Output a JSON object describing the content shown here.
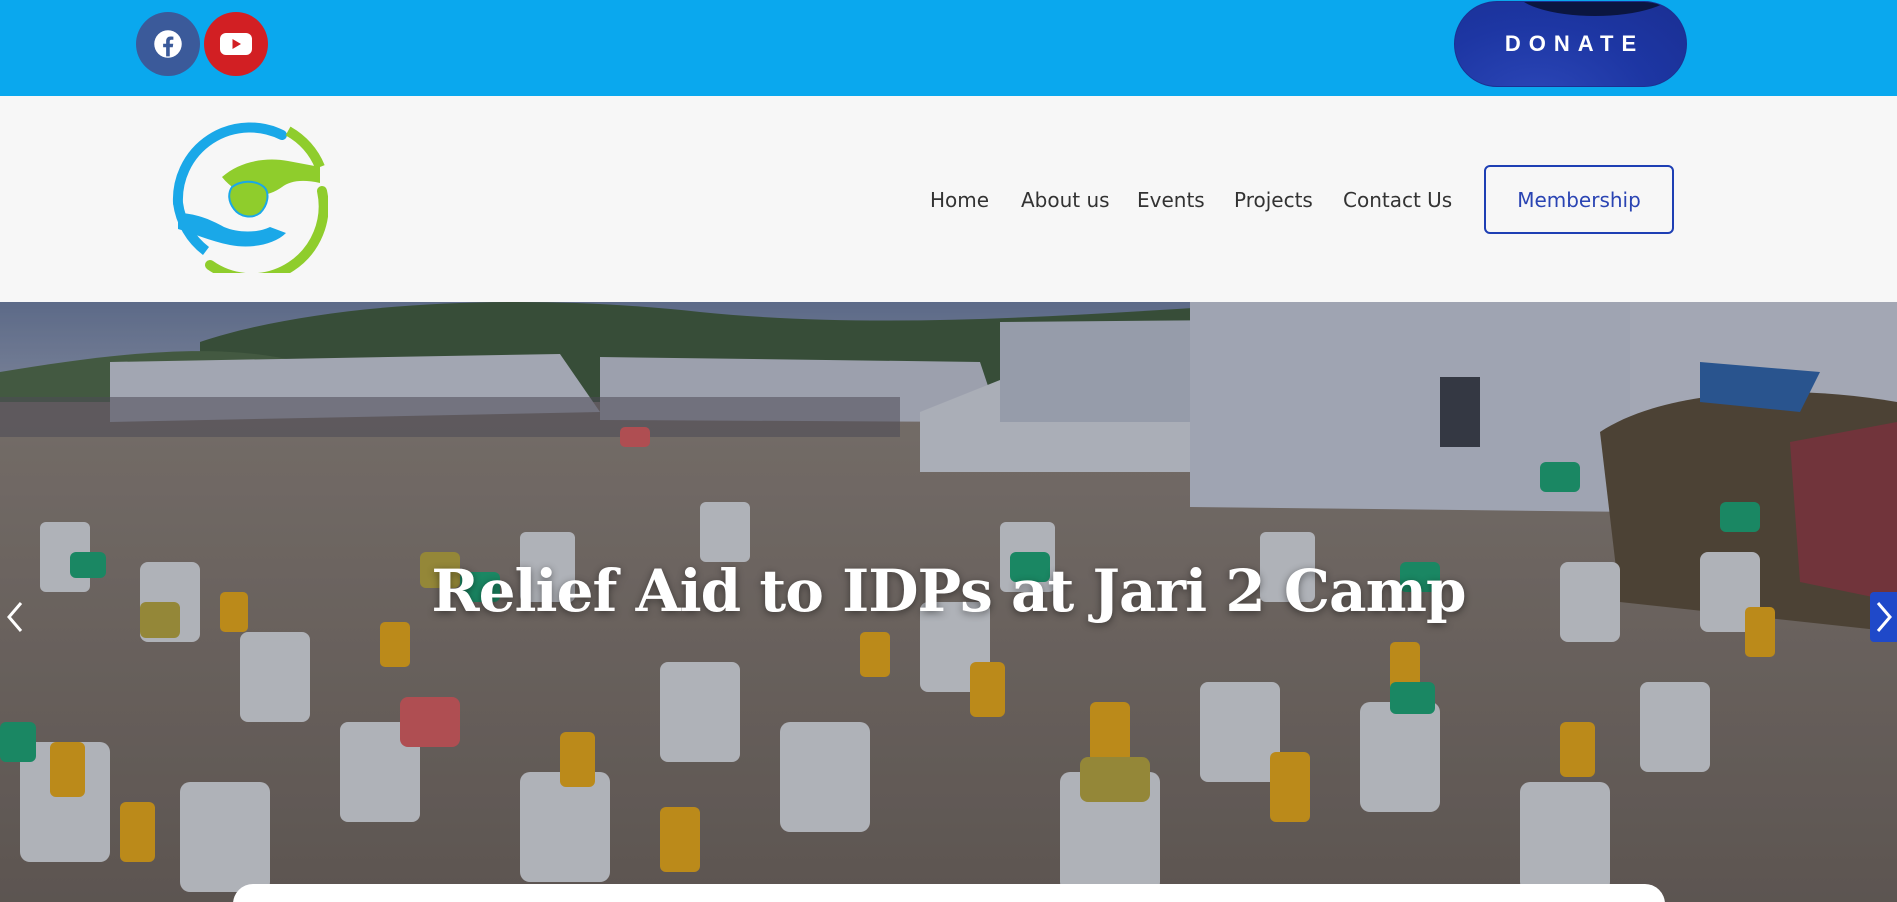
{
  "topbar": {
    "social": [
      {
        "name": "facebook-icon",
        "color": "#3b5a9a"
      },
      {
        "name": "youtube-icon",
        "color": "#d21f23"
      }
    ],
    "donate_label": "DONATE",
    "background": "#0aa8ee"
  },
  "header": {
    "logo_icon": "hands-holding-ethiopia-map-logo",
    "nav": {
      "home": "Home",
      "about": "About us",
      "events": "Events",
      "projects": "Projects",
      "contact": "Contact Us"
    },
    "membership_label": "Membership",
    "accent": "#1e3fb4"
  },
  "hero": {
    "title": "Relief Aid to IDPs at Jari 2 Camp",
    "prev_icon": "chevron-left-icon",
    "next_icon": "chevron-right-icon"
  }
}
